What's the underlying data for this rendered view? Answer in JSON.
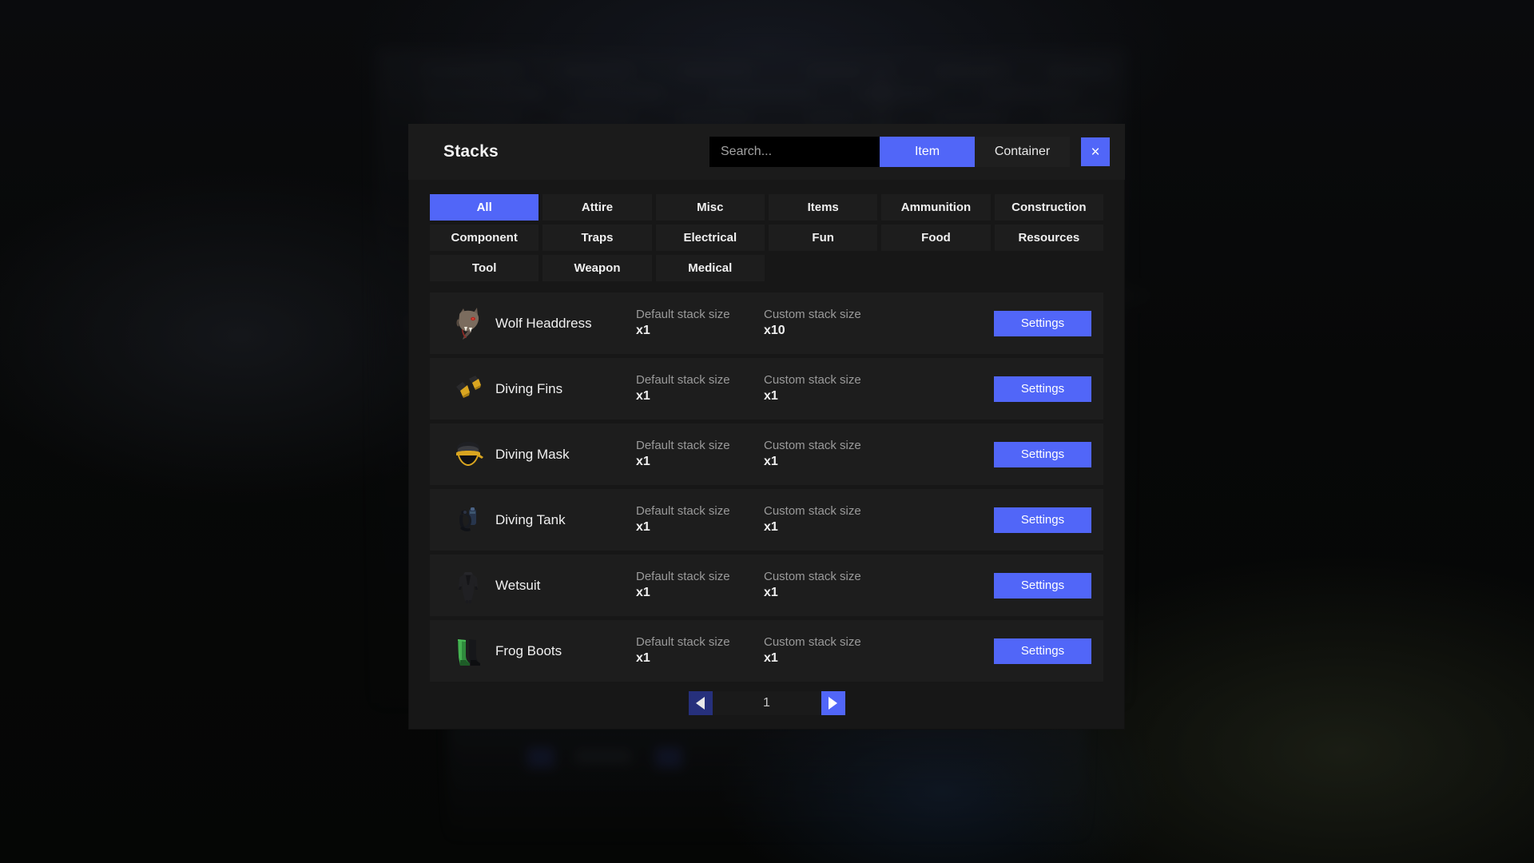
{
  "window": {
    "title": "Stacks"
  },
  "header": {
    "title": "Stacks",
    "search": {
      "placeholder": "Search...",
      "value": ""
    },
    "mode_buttons": [
      {
        "label": "Item",
        "active": true
      },
      {
        "label": "Container",
        "active": false
      }
    ],
    "close_label": "×"
  },
  "categories": [
    {
      "label": "All",
      "active": true
    },
    {
      "label": "Attire",
      "active": false
    },
    {
      "label": "Misc",
      "active": false
    },
    {
      "label": "Items",
      "active": false
    },
    {
      "label": "Ammunition",
      "active": false
    },
    {
      "label": "Construction",
      "active": false
    },
    {
      "label": "Component",
      "active": false
    },
    {
      "label": "Traps",
      "active": false
    },
    {
      "label": "Electrical",
      "active": false
    },
    {
      "label": "Fun",
      "active": false
    },
    {
      "label": "Food",
      "active": false
    },
    {
      "label": "Resources",
      "active": false
    },
    {
      "label": "Tool",
      "active": false
    },
    {
      "label": "Weapon",
      "active": false
    },
    {
      "label": "Medical",
      "active": false
    }
  ],
  "list": {
    "default_label": "Default stack size",
    "custom_label": "Custom stack size",
    "settings_label": "Settings",
    "rows": [
      {
        "icon": "wolf-headdress-icon",
        "name": "Wolf Headdress",
        "default_label": "Default stack size",
        "default_value": "x1",
        "custom_label": "Custom stack size",
        "custom_value": "x10",
        "settings_label": "Settings"
      },
      {
        "icon": "diving-fins-icon",
        "name": "Diving Fins",
        "default_label": "Default stack size",
        "default_value": "x1",
        "custom_label": "Custom stack size",
        "custom_value": "x1",
        "settings_label": "Settings"
      },
      {
        "icon": "diving-mask-icon",
        "name": "Diving Mask",
        "default_label": "Default stack size",
        "default_value": "x1",
        "custom_label": "Custom stack size",
        "custom_value": "x1",
        "settings_label": "Settings"
      },
      {
        "icon": "diving-tank-icon",
        "name": "Diving Tank",
        "default_label": "Default stack size",
        "default_value": "x1",
        "custom_label": "Custom stack size",
        "custom_value": "x1",
        "settings_label": "Settings"
      },
      {
        "icon": "wetsuit-icon",
        "name": "Wetsuit",
        "default_label": "Default stack size",
        "default_value": "x1",
        "custom_label": "Custom stack size",
        "custom_value": "x1",
        "settings_label": "Settings"
      },
      {
        "icon": "frog-boots-icon",
        "name": "Frog Boots",
        "default_label": "Default stack size",
        "default_value": "x1",
        "custom_label": "Custom stack size",
        "custom_value": "x1",
        "settings_label": "Settings"
      }
    ]
  },
  "pagination": {
    "prev_icon": "triangle-left-icon",
    "next_icon": "triangle-right-icon",
    "page": "1",
    "prev_enabled": false,
    "next_enabled": true
  },
  "colors": {
    "accent": "#5166f8",
    "accent_disabled": "#26307c",
    "panel": "#171717",
    "header": "#1b1b1b",
    "row": "#1d1d1d",
    "text": "#f0f0f0",
    "muted_text": "#9a9a9a",
    "search_bg": "#000000"
  }
}
